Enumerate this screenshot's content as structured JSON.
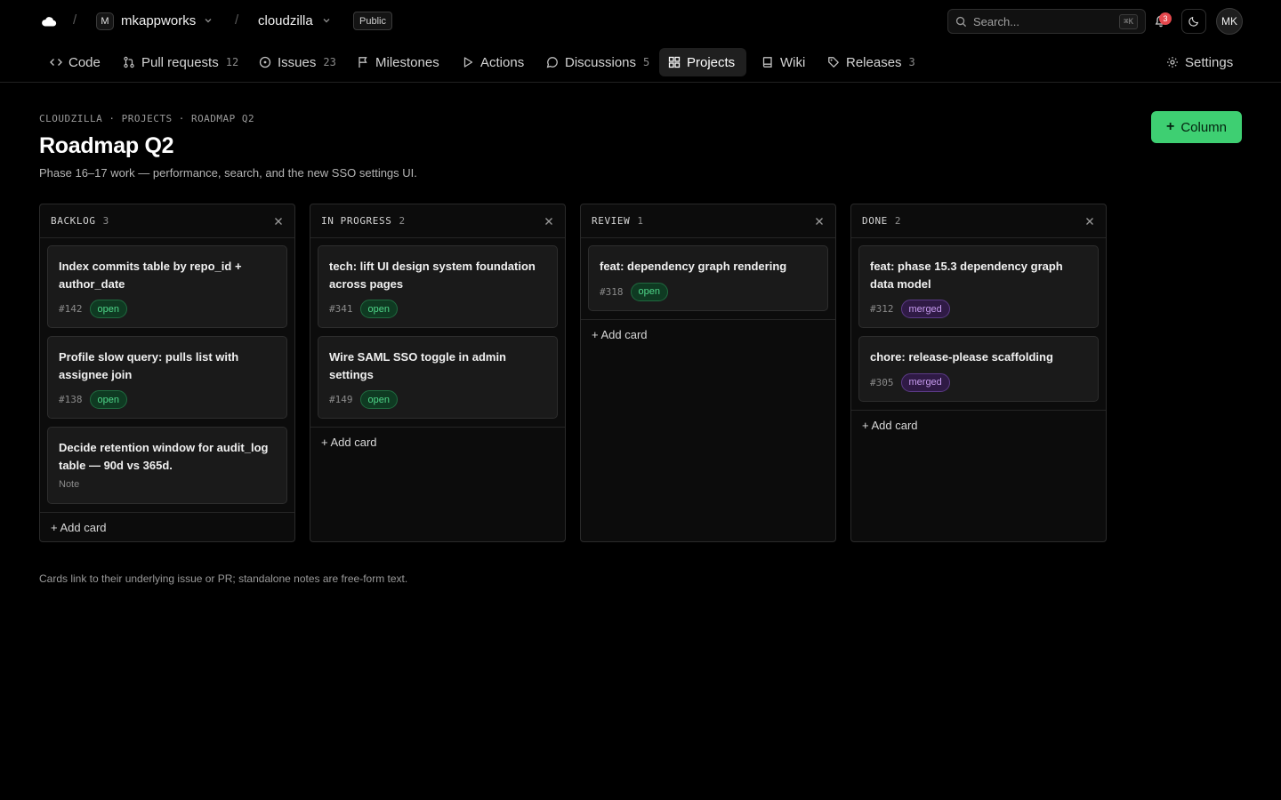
{
  "topbar": {
    "owner_initial": "M",
    "owner": "mkappworks",
    "repo": "cloudzilla",
    "visibility": "Public",
    "search_placeholder": "Search...",
    "search_shortcut": "⌘K",
    "notifications": "3",
    "user_initials": "MK"
  },
  "nav": {
    "tabs": [
      {
        "label": "Code",
        "icon": "code-icon"
      },
      {
        "label": "Pull requests",
        "count": "12",
        "icon": "pull-request-icon"
      },
      {
        "label": "Issues",
        "count": "23",
        "icon": "issue-icon"
      },
      {
        "label": "Milestones",
        "icon": "flag-icon"
      },
      {
        "label": "Actions",
        "icon": "play-icon"
      },
      {
        "label": "Discussions",
        "count": "5",
        "icon": "discussion-icon"
      },
      {
        "label": "Projects",
        "icon": "projects-icon",
        "active": true
      },
      {
        "label": "Wiki",
        "icon": "book-icon"
      },
      {
        "label": "Releases",
        "count": "3",
        "icon": "tag-icon"
      }
    ],
    "settings": "Settings"
  },
  "header": {
    "breadcrumb": "CLOUDZILLA · PROJECTS · ROADMAP Q2",
    "title": "Roadmap Q2",
    "subtitle": "Phase 16–17 work — performance, search, and the new SSO settings UI.",
    "add_column_label": "Column"
  },
  "columns": [
    {
      "title": "BACKLOG",
      "count": "3",
      "cards": [
        {
          "title": "Index commits table by repo_id + author_date",
          "number": "#142",
          "state": "open"
        },
        {
          "title": "Profile slow query: pulls list with assignee join",
          "number": "#138",
          "state": "open"
        },
        {
          "title": "Decide retention window for audit_log table — 90d vs 365d.",
          "note": "Note"
        }
      ],
      "add_card": "+ Add card"
    },
    {
      "title": "IN PROGRESS",
      "count": "2",
      "cards": [
        {
          "title": "tech: lift UI design system foundation across pages",
          "number": "#341",
          "state": "open"
        },
        {
          "title": "Wire SAML SSO toggle in admin settings",
          "number": "#149",
          "state": "open"
        }
      ],
      "add_card": "+ Add card"
    },
    {
      "title": "REVIEW",
      "count": "1",
      "cards": [
        {
          "title": "feat: dependency graph rendering",
          "number": "#318",
          "state": "open"
        }
      ],
      "add_card": "+ Add card"
    },
    {
      "title": "DONE",
      "count": "2",
      "cards": [
        {
          "title": "feat: phase 15.3 dependency graph data model",
          "number": "#312",
          "state": "merged"
        },
        {
          "title": "chore: release-please scaffolding",
          "number": "#305",
          "state": "merged"
        }
      ],
      "add_card": "+ Add card"
    }
  ],
  "footer_note": "Cards link to their underlying issue or PR; standalone notes are free-form text.",
  "colors": {
    "accent": "#3ecf72",
    "open": "#4fd689",
    "merged": "#c79bf0",
    "notification": "#e5484d"
  }
}
